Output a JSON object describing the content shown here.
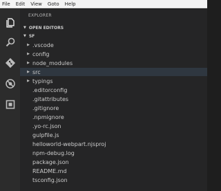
{
  "menubar": {
    "items": [
      "File",
      "Edit",
      "View",
      "Goto",
      "Help"
    ]
  },
  "activity_bar": {
    "icons": [
      "files-icon",
      "search-icon",
      "git-icon",
      "debug-icon",
      "extensions-icon"
    ]
  },
  "sidebar": {
    "title": "EXPLORER",
    "open_editors": "OPEN EDITORS",
    "project": "SF",
    "tree": [
      {
        "label": ".vscode",
        "type": "folder"
      },
      {
        "label": "config",
        "type": "folder"
      },
      {
        "label": "node_modules",
        "type": "folder"
      },
      {
        "label": "src",
        "type": "folder",
        "selected": true
      },
      {
        "label": "typings",
        "type": "folder"
      },
      {
        "label": ".editorconfig",
        "type": "file"
      },
      {
        "label": ".gitattributes",
        "type": "file"
      },
      {
        "label": ".gitignore",
        "type": "file"
      },
      {
        "label": ".npmignore",
        "type": "file"
      },
      {
        "label": ".yo-rc.json",
        "type": "file"
      },
      {
        "label": "gulpfile.js",
        "type": "file"
      },
      {
        "label": "helloworld-webpart.njsproj",
        "type": "file"
      },
      {
        "label": "npm-debug.log",
        "type": "file"
      },
      {
        "label": "package.json",
        "type": "file"
      },
      {
        "label": "README.md",
        "type": "file"
      },
      {
        "label": "tsconfig.json",
        "type": "file"
      }
    ]
  },
  "colors": {
    "activity_bar": "#2c2c2c",
    "sidebar": "#252526",
    "selection": "#2f3740",
    "text": "#cccccc"
  }
}
